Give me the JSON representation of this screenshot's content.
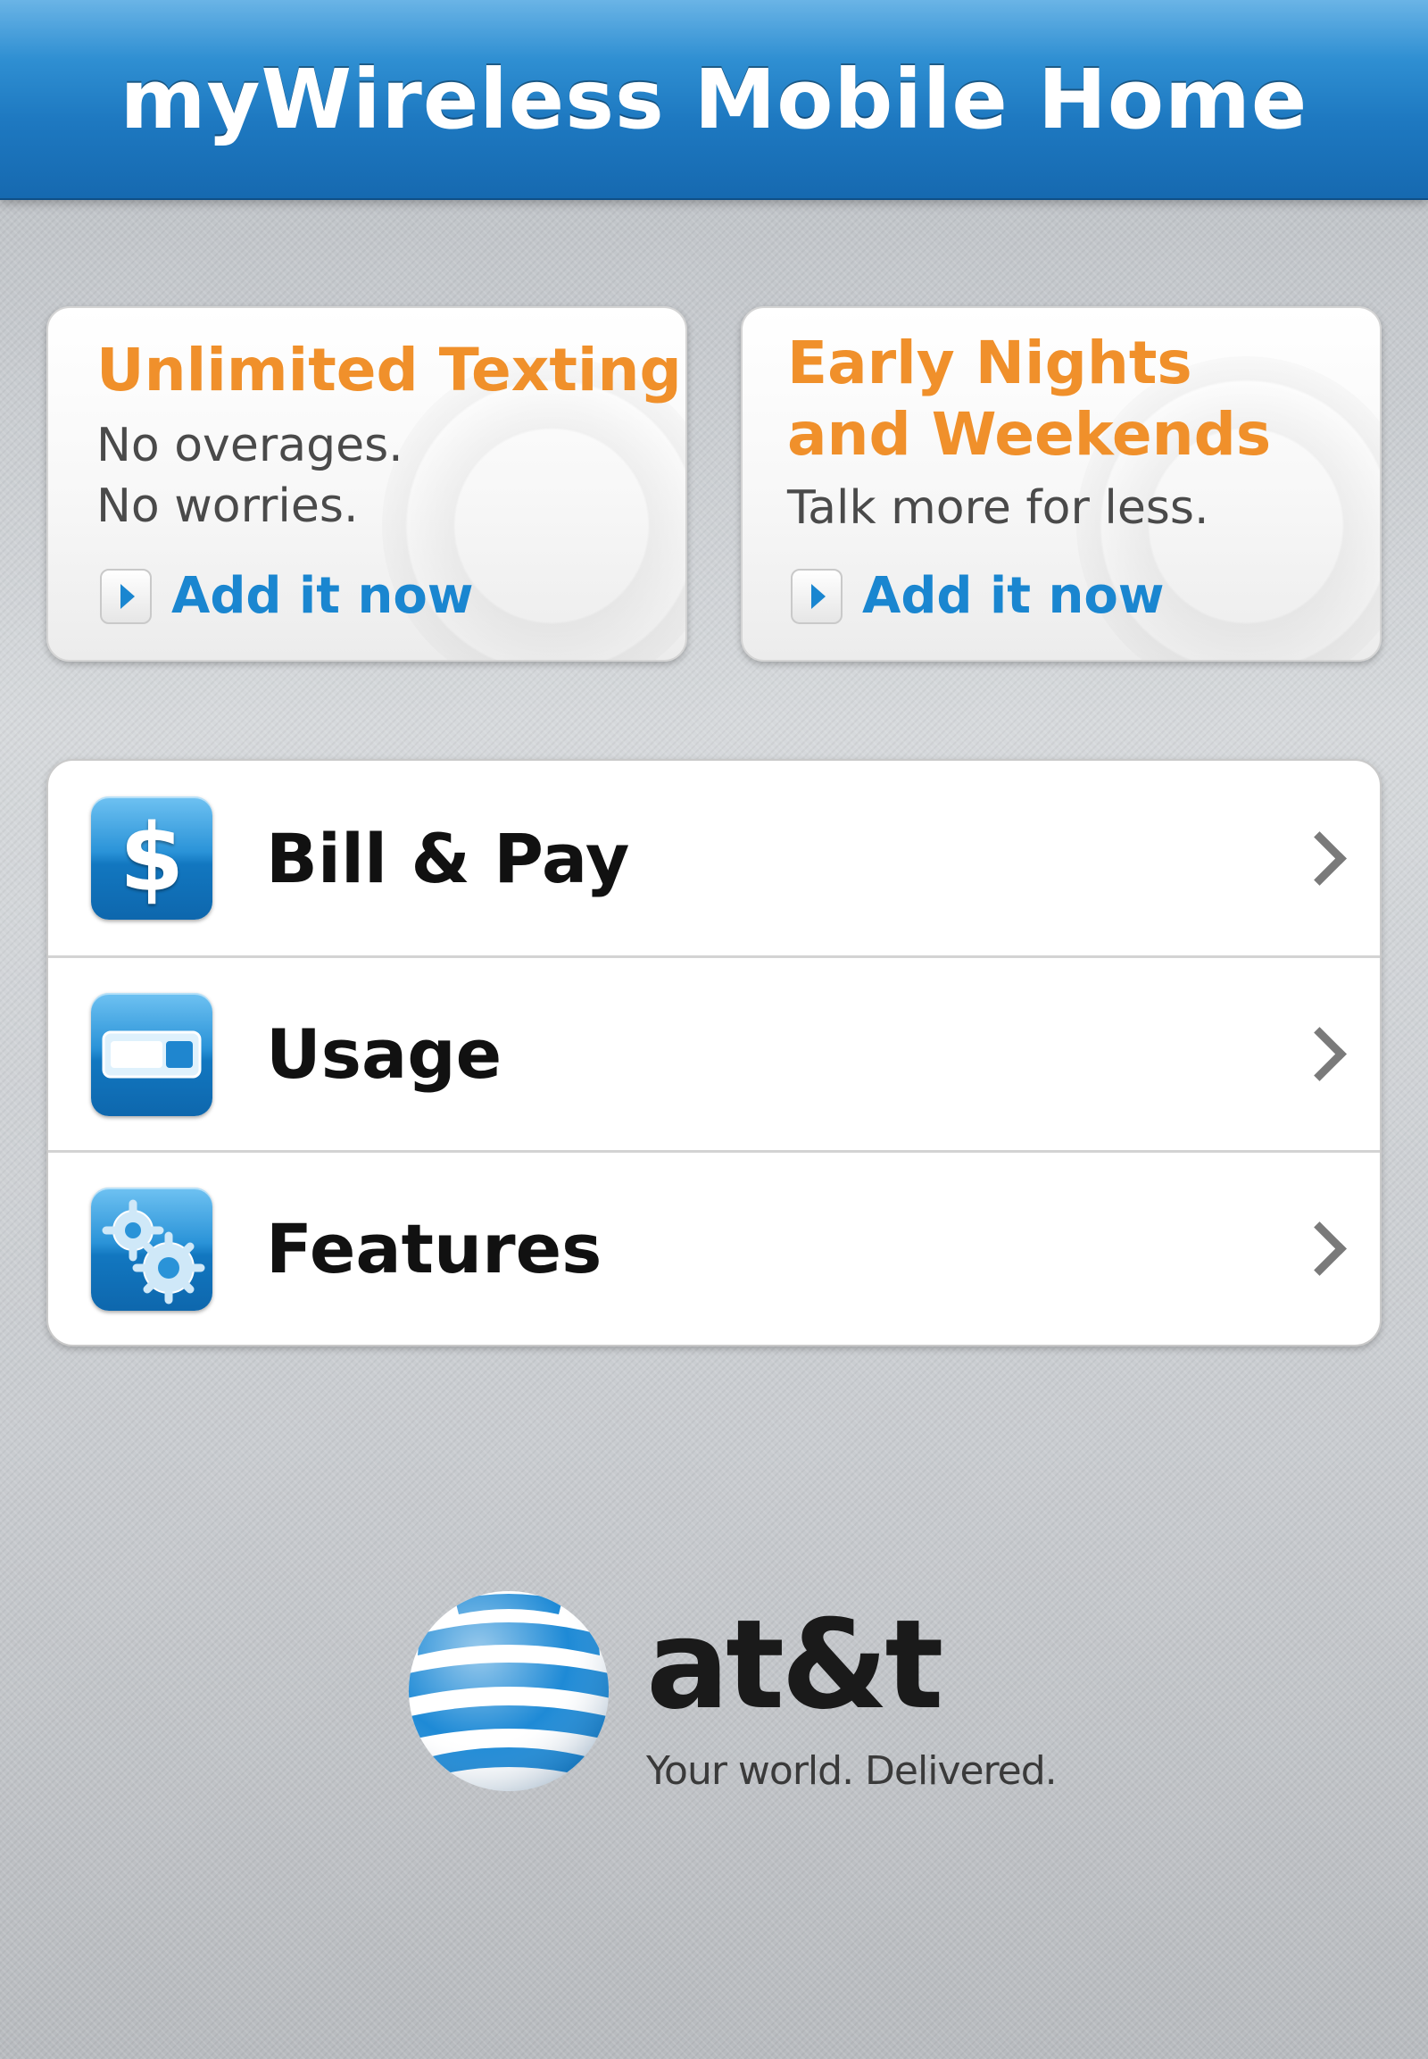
{
  "header": {
    "title": "myWireless Mobile Home"
  },
  "promos": [
    {
      "title_lines": [
        "Unlimited Texting"
      ],
      "desc_lines": [
        "No overages.",
        "No worries."
      ],
      "cta": "Add it now"
    },
    {
      "title_lines": [
        "Early Nights",
        "and Weekends"
      ],
      "desc_lines": [
        "Talk more for less."
      ],
      "cta": "Add it now"
    }
  ],
  "menu": {
    "items": [
      {
        "label": "Bill & Pay",
        "icon": "dollar-icon"
      },
      {
        "label": "Usage",
        "icon": "usage-meter-icon"
      },
      {
        "label": "Features",
        "icon": "gears-icon"
      }
    ],
    "dollar_glyph": "$"
  },
  "brand": {
    "name": "at&t",
    "tagline": "Your world. Delivered.",
    "logo_icon": "att-globe-icon"
  },
  "colors": {
    "header_blue": "#1e79c1",
    "promo_orange": "#f0902b",
    "link_blue": "#1a86d0",
    "icon_blue": "#2a93d8"
  }
}
